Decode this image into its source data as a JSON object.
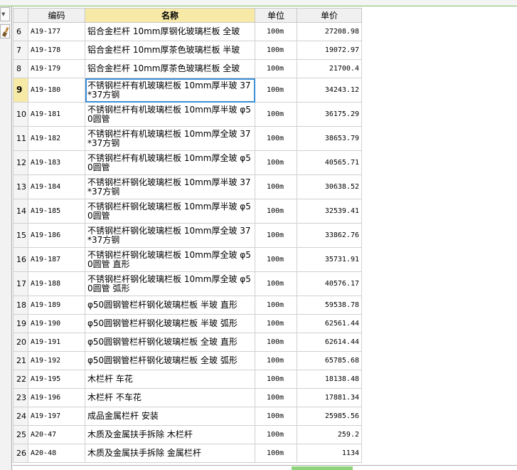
{
  "columns": {
    "index": "",
    "code": "编码",
    "name": "名称",
    "unit": "单位",
    "price": "单价"
  },
  "icons": {
    "dropdown": "chevron-down-icon",
    "brush": "brush-icon"
  },
  "colors": {
    "header_active": "#f7e9a6",
    "selection_border": "#3b8ed6",
    "scroll_thumb": "#8fd47a"
  },
  "selected_row": "9",
  "rows": [
    {
      "index": "6",
      "code": "A19-177",
      "name": "铝合金栏杆 10mm厚钢化玻璃栏板 全玻",
      "unit": "100m",
      "price": "27208.98"
    },
    {
      "index": "7",
      "code": "A19-178",
      "name": "铝合金栏杆 10mm厚茶色玻璃栏板 半玻",
      "unit": "100m",
      "price": "19072.97"
    },
    {
      "index": "8",
      "code": "A19-179",
      "name": "铝合金栏杆 10mm厚茶色玻璃栏板 全玻",
      "unit": "100m",
      "price": "21700.4"
    },
    {
      "index": "9",
      "code": "A19-180",
      "name": "不锈钢栏杆有机玻璃栏板 10mm厚半玻 37*37方钢",
      "unit": "100m",
      "price": "34243.12"
    },
    {
      "index": "10",
      "code": "A19-181",
      "name": "不锈钢栏杆有机玻璃栏板 10mm厚半玻 φ50圆管",
      "unit": "100m",
      "price": "36175.29"
    },
    {
      "index": "11",
      "code": "A19-182",
      "name": "不锈钢栏杆有机玻璃栏板 10mm厚全玻 37*37方钢",
      "unit": "100m",
      "price": "38653.79"
    },
    {
      "index": "12",
      "code": "A19-183",
      "name": "不锈钢栏杆有机玻璃栏板 10mm厚全玻 φ50圆管",
      "unit": "100m",
      "price": "40565.71"
    },
    {
      "index": "13",
      "code": "A19-184",
      "name": "不锈钢栏杆钢化玻璃栏板 10mm厚半玻 37*37方钢",
      "unit": "100m",
      "price": "30638.52"
    },
    {
      "index": "14",
      "code": "A19-185",
      "name": "不锈钢栏杆钢化玻璃栏板 10mm厚半玻 φ50圆管",
      "unit": "100m",
      "price": "32539.41"
    },
    {
      "index": "15",
      "code": "A19-186",
      "name": "不锈钢栏杆钢化玻璃栏板 10mm厚全玻 37*37方钢",
      "unit": "100m",
      "price": "33862.76"
    },
    {
      "index": "16",
      "code": "A19-187",
      "name": "不锈钢栏杆钢化玻璃栏板 10mm厚全玻 φ50圆管 直形",
      "unit": "100m",
      "price": "35731.91"
    },
    {
      "index": "17",
      "code": "A19-188",
      "name": "不锈钢栏杆钢化玻璃栏板 10mm厚全玻 φ50圆管 弧形",
      "unit": "100m",
      "price": "40576.17"
    },
    {
      "index": "18",
      "code": "A19-189",
      "name": "φ50圆钢管栏杆钢化玻璃栏板 半玻 直形",
      "unit": "100m",
      "price": "59538.78"
    },
    {
      "index": "19",
      "code": "A19-190",
      "name": "φ50圆钢管栏杆钢化玻璃栏板 半玻 弧形",
      "unit": "100m",
      "price": "62561.44"
    },
    {
      "index": "20",
      "code": "A19-191",
      "name": "φ50圆钢管栏杆钢化玻璃栏板 全玻 直形",
      "unit": "100m",
      "price": "62614.44"
    },
    {
      "index": "21",
      "code": "A19-192",
      "name": "φ50圆钢管栏杆钢化玻璃栏板 全玻 弧形",
      "unit": "100m",
      "price": "65785.68"
    },
    {
      "index": "22",
      "code": "A19-195",
      "name": "木栏杆 车花",
      "unit": "100m",
      "price": "18138.48"
    },
    {
      "index": "23",
      "code": "A19-196",
      "name": "木栏杆 不车花",
      "unit": "100m",
      "price": "17881.34"
    },
    {
      "index": "24",
      "code": "A19-197",
      "name": "成品金属栏杆 安装",
      "unit": "100m",
      "price": "25985.56"
    },
    {
      "index": "25",
      "code": "A20-47",
      "name": "木质及金属扶手拆除 木栏杆",
      "unit": "100m",
      "price": "259.2"
    },
    {
      "index": "26",
      "code": "A20-48",
      "name": "木质及金属扶手拆除 金属栏杆",
      "unit": "100m",
      "price": "1134"
    }
  ]
}
